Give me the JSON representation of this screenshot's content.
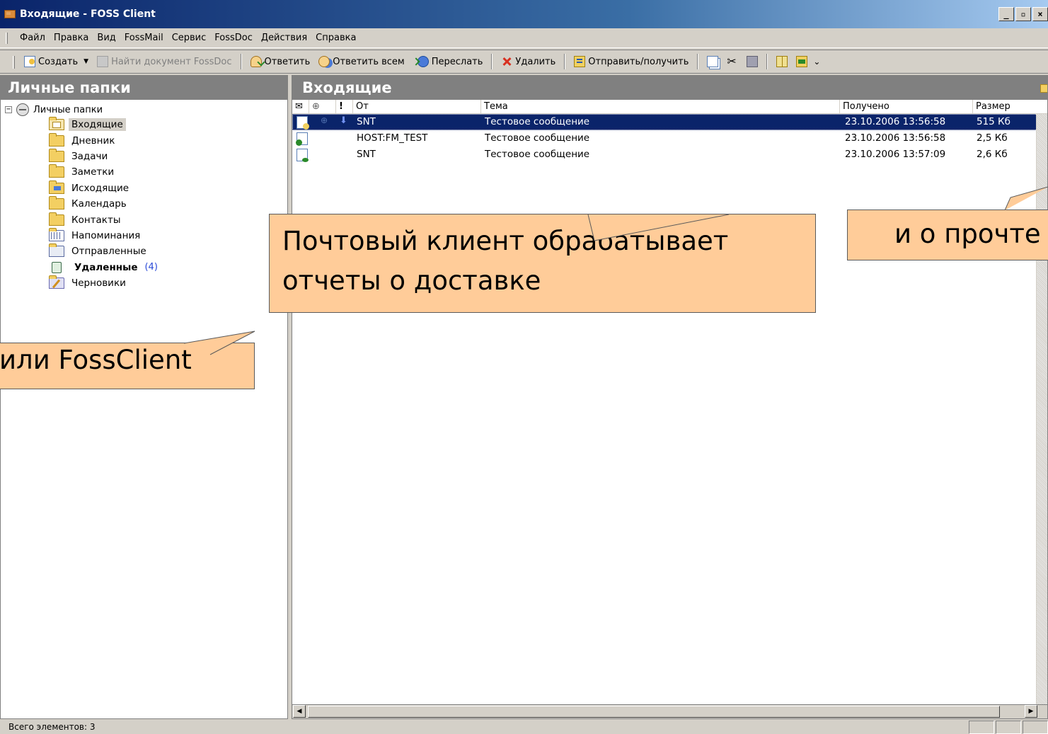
{
  "window": {
    "title": "Входящие - FOSS Client",
    "controls": [
      "_",
      "▫",
      "×"
    ]
  },
  "menu": [
    "Файл",
    "Правка",
    "Вид",
    "FossMail",
    "Сервис",
    "FossDoc",
    "Действия",
    "Справка"
  ],
  "toolbar": {
    "create": "Создать",
    "find_doc": "Найти документ FossDoc",
    "reply": "Ответить",
    "reply_all": "Ответить всем",
    "forward": "Переслать",
    "delete": "Удалить",
    "send_receive": "Отправить/получить"
  },
  "left_pane": {
    "header": "Личные папки",
    "root": "Личные папки",
    "folders": [
      {
        "label": "Входящие",
        "icon": "inbox-folder-icon",
        "selected": true
      },
      {
        "label": "Дневник",
        "icon": "folder-icon"
      },
      {
        "label": "Задачи",
        "icon": "folder-icon"
      },
      {
        "label": "Заметки",
        "icon": "folder-icon"
      },
      {
        "label": "Исходящие",
        "icon": "outbox-folder-icon"
      },
      {
        "label": "Календарь",
        "icon": "folder-icon"
      },
      {
        "label": "Контакты",
        "icon": "folder-icon"
      },
      {
        "label": "Напоминания",
        "icon": "reminders-icon"
      },
      {
        "label": "Отправленные",
        "icon": "sent-folder-icon"
      },
      {
        "label": "Удаленные",
        "icon": "trash-icon",
        "bold": true,
        "count": "(4)"
      },
      {
        "label": "Черновики",
        "icon": "drafts-icon"
      }
    ]
  },
  "right_pane": {
    "header": "Входящие",
    "columns": {
      "envelope": "✉",
      "attach": "⊕",
      "priority": "!",
      "from": "От",
      "subject": "Тема",
      "received": "Получено",
      "size": "Размер"
    },
    "messages": [
      {
        "from": "SNT",
        "subject": "Тестовое сообщение",
        "received": "23.10.2006 13:56:58",
        "size": "515 Кб",
        "selected": true
      },
      {
        "from": "HOST:FM_TEST",
        "subject": "Тестовое сообщение",
        "received": "23.10.2006 13:56:58",
        "size": "2,5 Кб"
      },
      {
        "from": "SNT",
        "subject": "Тестовое сообщение",
        "received": "23.10.2006 13:57:09",
        "size": "2,6 Кб"
      }
    ]
  },
  "status": {
    "total": "Всего элементов: 3"
  },
  "callouts": {
    "main_line1": "Почтовый клиент обрабатывает",
    "main_line2": "отчеты о доставке",
    "right": "и о прочте",
    "left": "или FossClient"
  },
  "colors": {
    "titlebar": "#0a246a",
    "callout_fill": "#ffcc99",
    "selection": "#0a246a",
    "pane_header": "#808080"
  }
}
